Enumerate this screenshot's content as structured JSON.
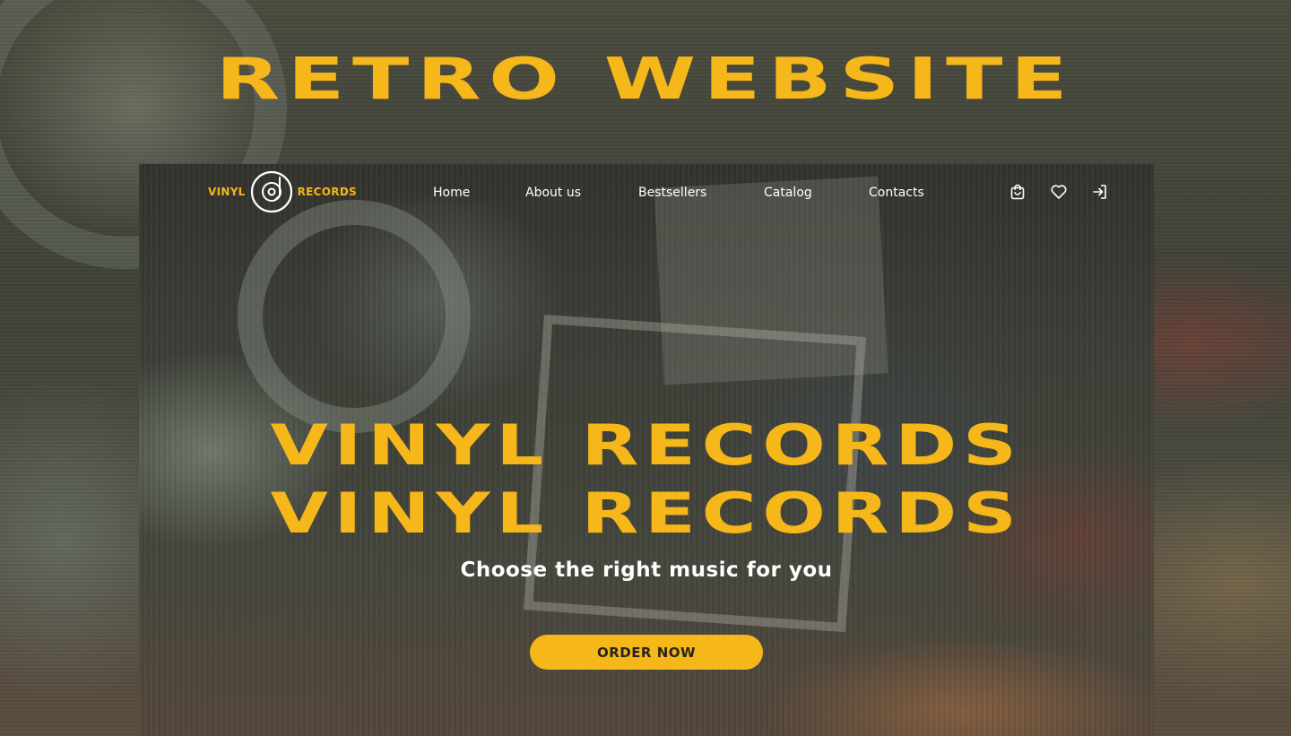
{
  "page": {
    "heading": "RETRO WEBSITE"
  },
  "logo": {
    "left_text": "VINYL",
    "right_text": "RECORDS",
    "icon": "vinyl-record-icon"
  },
  "nav": {
    "items": [
      {
        "label": "Home"
      },
      {
        "label": "About us"
      },
      {
        "label": "Bestsellers"
      },
      {
        "label": "Catalog"
      },
      {
        "label": "Contacts"
      }
    ],
    "icons": [
      "shopping-bag-icon",
      "heart-icon",
      "login-icon"
    ]
  },
  "hero": {
    "title_line_1": "VINYL RECORDS",
    "title_line_2": "VINYL RECORDS",
    "subtitle": "Choose the right music for you",
    "cta_label": "ORDER NOW"
  },
  "colors": {
    "accent": "#f5b719",
    "text_light": "#ffffff",
    "button_text": "#2a2218"
  }
}
